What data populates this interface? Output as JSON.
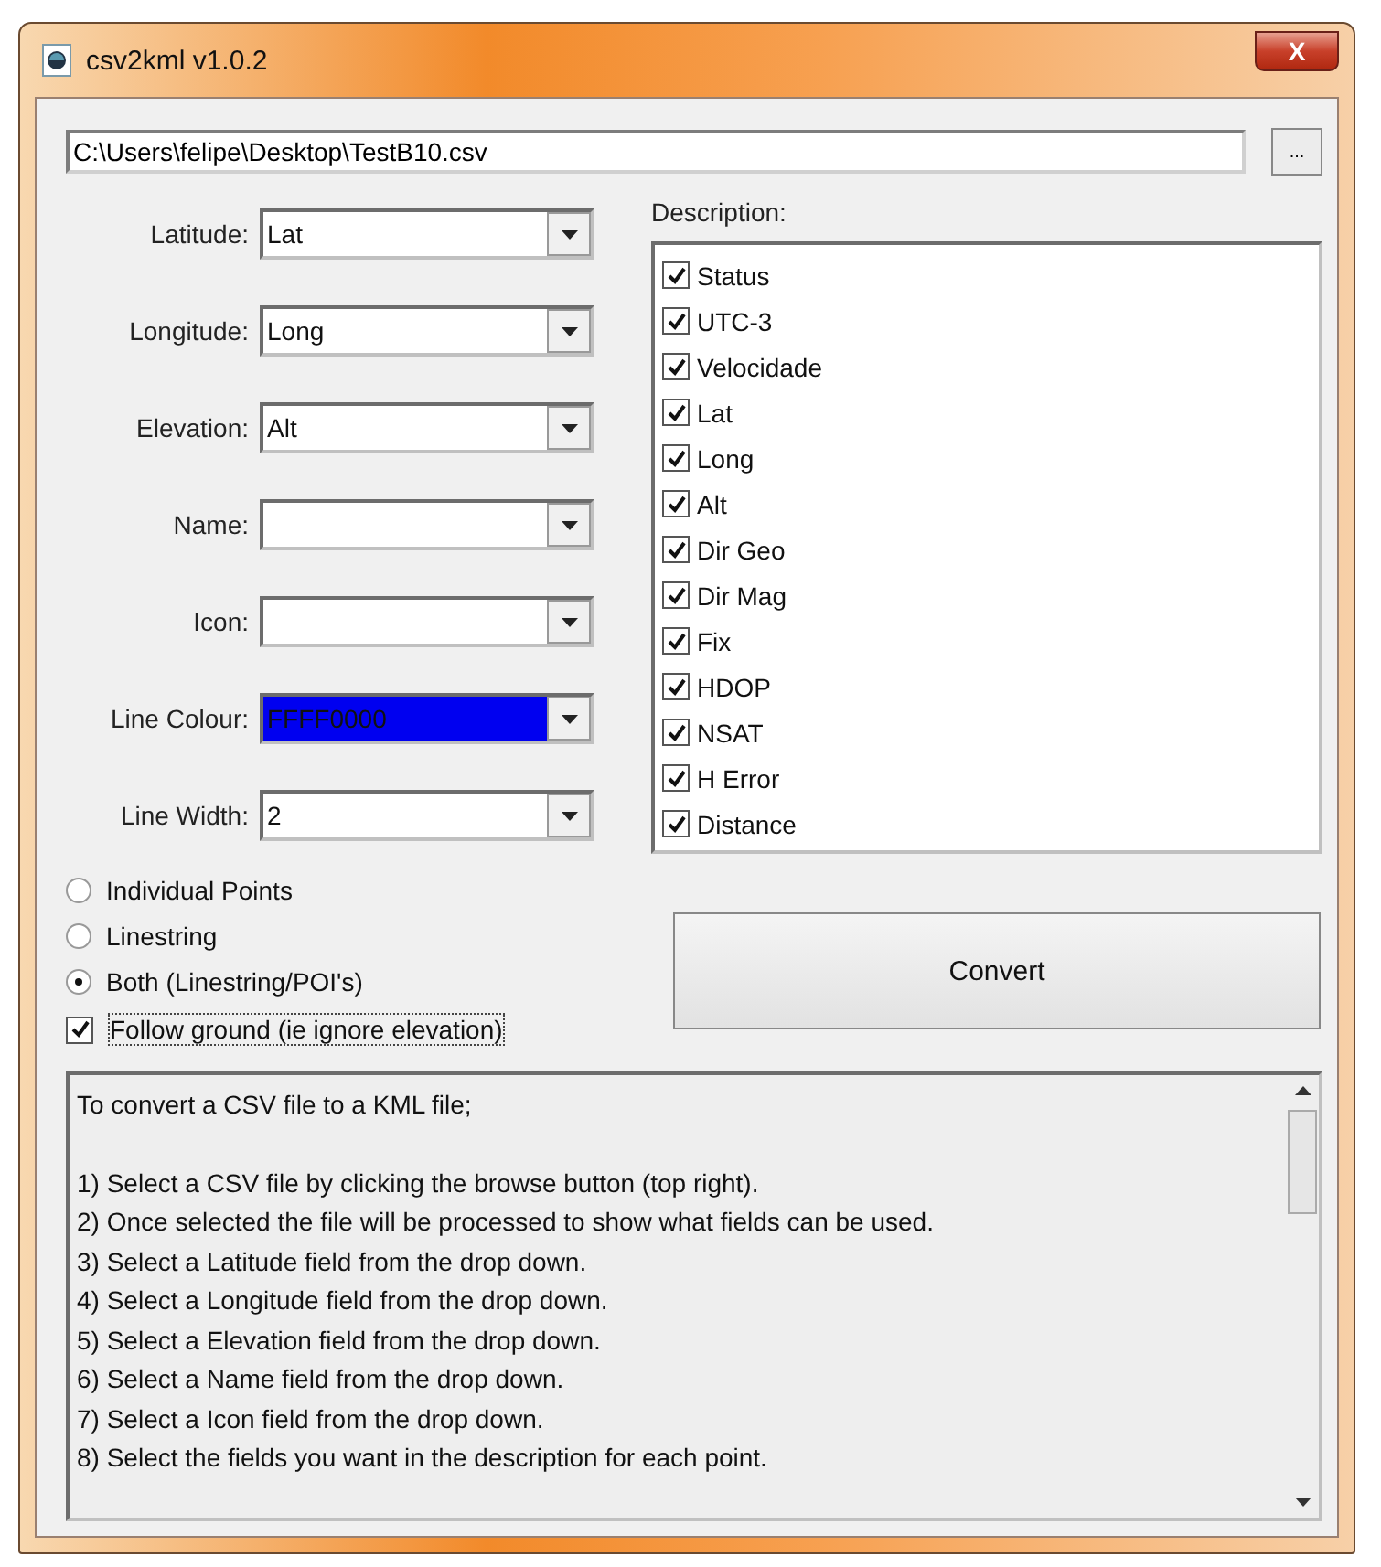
{
  "window": {
    "title": "csv2kml v1.0.2",
    "close": "X"
  },
  "file": {
    "value": "C:\\Users\\felipe\\Desktop\\TestB10.csv",
    "browse": "..."
  },
  "fields": [
    {
      "label": "Latitude:",
      "value": "Lat"
    },
    {
      "label": "Longitude:",
      "value": "Long"
    },
    {
      "label": "Elevation:",
      "value": "Alt"
    },
    {
      "label": "Name:"
    },
    {
      "label": "Icon:"
    },
    {
      "label": "Line Colour:",
      "value": "FFFF0000",
      "color": "#0000f0"
    },
    {
      "label": "Line Width:",
      "value": "2"
    }
  ],
  "description": {
    "label": "Description:",
    "items": [
      {
        "label": "Status",
        "checked": true
      },
      {
        "label": "UTC-3",
        "checked": true
      },
      {
        "label": "Velocidade",
        "checked": true
      },
      {
        "label": "Lat",
        "checked": true
      },
      {
        "label": "Long",
        "checked": true
      },
      {
        "label": "Alt",
        "checked": true
      },
      {
        "label": "Dir Geo",
        "checked": true
      },
      {
        "label": "Dir Mag",
        "checked": true
      },
      {
        "label": "Fix",
        "checked": true
      },
      {
        "label": "HDOP",
        "checked": true
      },
      {
        "label": "NSAT",
        "checked": true
      },
      {
        "label": "H Error",
        "checked": true
      },
      {
        "label": "Distance",
        "checked": true
      }
    ]
  },
  "modes": [
    {
      "label": "Individual Points",
      "selected": false
    },
    {
      "label": "Linestring",
      "selected": false
    },
    {
      "label": "Both (Linestring/POI's)",
      "selected": true
    }
  ],
  "follow_ground": {
    "label": "Follow ground (ie ignore elevation)",
    "checked": true
  },
  "convert": "Convert",
  "help": {
    "intro": "To convert a CSV file to a KML file;",
    "steps": [
      "1) Select a CSV file by clicking the browse button (top right).",
      "2) Once selected the file will be processed to show what fields can be used.",
      "3) Select a Latitude field from the drop down.",
      "4) Select a Longitude field from the drop down.",
      "5) Select a Elevation field from the drop down.",
      "6) Select a Name field from the drop down.",
      "7) Select a Icon field from the drop down.",
      "8) Select the fields you want in the description for each point."
    ]
  }
}
